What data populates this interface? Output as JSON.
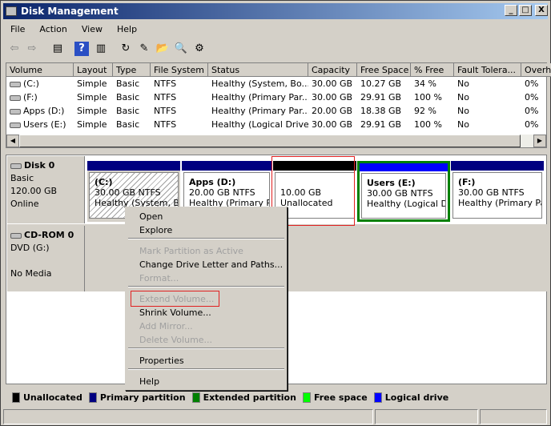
{
  "window": {
    "title": "Disk Management",
    "controls": [
      "_",
      "□",
      "X"
    ]
  },
  "menu": [
    "File",
    "Action",
    "View",
    "Help"
  ],
  "toolbar": [
    {
      "icon": "back-icon",
      "g": "⇦"
    },
    {
      "icon": "forward-icon",
      "g": "⇨"
    },
    {
      "icon": "show-hide-console-tree-icon",
      "g": "▤"
    },
    {
      "icon": "help-icon",
      "g": "?"
    },
    {
      "icon": "show-hide-action-pane-icon",
      "g": "▥"
    },
    {
      "icon": "refresh-icon",
      "g": "↻"
    },
    {
      "icon": "properties-icon",
      "g": "✎"
    },
    {
      "icon": "open-folder-icon",
      "g": "📂"
    },
    {
      "icon": "search-icon",
      "g": "🔍"
    },
    {
      "icon": "settings-icon",
      "g": "⚙"
    }
  ],
  "table": {
    "columns": [
      "Volume",
      "Layout",
      "Type",
      "File System",
      "Status",
      "Capacity",
      "Free Space",
      "% Free",
      "Fault Tolera...",
      "Overh"
    ],
    "rows": [
      [
        "(C:)",
        "Simple",
        "Basic",
        "NTFS",
        "Healthy (System, Bo...",
        "30.00 GB",
        "10.27 GB",
        "34 %",
        "No",
        "0%"
      ],
      [
        "(F:)",
        "Simple",
        "Basic",
        "NTFS",
        "Healthy (Primary Par...",
        "30.00 GB",
        "29.91 GB",
        "100 %",
        "No",
        "0%"
      ],
      [
        "Apps (D:)",
        "Simple",
        "Basic",
        "NTFS",
        "Healthy (Primary Par...",
        "20.00 GB",
        "18.38 GB",
        "92 %",
        "No",
        "0%"
      ],
      [
        "Users (E:)",
        "Simple",
        "Basic",
        "NTFS",
        "Healthy (Logical Drive)",
        "30.00 GB",
        "29.91 GB",
        "100 %",
        "No",
        "0%"
      ]
    ]
  },
  "disks": [
    {
      "name": "Disk 0",
      "type": "Basic",
      "size": "120.00 GB",
      "state": "Online"
    },
    {
      "name": "CD-ROM 0",
      "type": "DVD (G:)",
      "size": "",
      "state": "No Media"
    }
  ],
  "partitions": [
    {
      "title": "(C:)",
      "size": "30.00 GB NTFS",
      "status": "Healthy (System, Boo",
      "color": "#000080"
    },
    {
      "title": "Apps  (D:)",
      "size": "20.00 GB NTFS",
      "status": "Healthy (Primary Par",
      "color": "#000080"
    },
    {
      "title": "",
      "size": "10.00 GB",
      "status": "Unallocated",
      "color": "#000000"
    },
    {
      "title": "Users  (E:)",
      "size": "30.00 GB NTFS",
      "status": "Healthy (Logical Driv",
      "color": "#0000ff"
    },
    {
      "title": "(F:)",
      "size": "30.00 GB NTFS",
      "status": "Healthy (Primary Part",
      "color": "#000080"
    }
  ],
  "context_menu": [
    {
      "label": "Open",
      "enabled": true
    },
    {
      "label": "Explore",
      "enabled": true
    },
    {
      "label": "Mark Partition as Active",
      "enabled": false
    },
    {
      "label": "Change Drive Letter and Paths...",
      "enabled": true
    },
    {
      "label": "Format...",
      "enabled": false
    },
    {
      "label": "Extend Volume...",
      "enabled": false
    },
    {
      "label": "Shrink Volume...",
      "enabled": true
    },
    {
      "label": "Add Mirror...",
      "enabled": false
    },
    {
      "label": "Delete Volume...",
      "enabled": false
    },
    {
      "label": "Properties",
      "enabled": true
    },
    {
      "label": "Help",
      "enabled": true
    }
  ],
  "legend": [
    {
      "label": "Unallocated",
      "color": "#000000"
    },
    {
      "label": "Primary partition",
      "color": "#000080"
    },
    {
      "label": "Extended partition",
      "color": "#008000"
    },
    {
      "label": "Free space",
      "color": "#00ff00"
    },
    {
      "label": "Logical drive",
      "color": "#0000ff"
    }
  ]
}
